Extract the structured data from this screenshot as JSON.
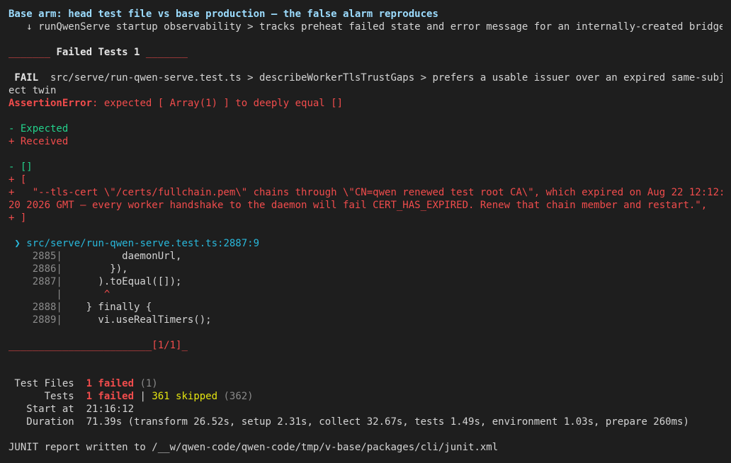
{
  "header": {
    "title": "Base arm: head test file vs base production — the false alarm reproduces",
    "skipped_line": "   ↓ runQwenServe startup observability > tracks preheat failed state and error message for an internally-created bridge"
  },
  "failed_banner": {
    "rule_left": "_______",
    "label": " Failed Tests 1 ",
    "rule_right": "_______"
  },
  "failure": {
    "badge": " FAIL ",
    "path_line1": " src/serve/run-qwen-serve.test.ts > describeWorkerTlsTrustGaps > prefers a usable issuer over an expired same-subj",
    "path_line2": "ect twin",
    "error_name": "AssertionError",
    "error_message": ": expected [ Array(1) ] to deeply equal []"
  },
  "diff": {
    "legend_expected": "- Expected",
    "legend_received": "+ Received",
    "lines": [
      {
        "type": "expected",
        "text": "- []"
      },
      {
        "type": "received",
        "text": "+ ["
      },
      {
        "type": "received",
        "text": "+   \"--tls-cert \\\"/certs/fullchain.pem\\\" chains through \\\"CN=qwen renewed test root CA\\\", which expired on Aug 22 12:12:"
      },
      {
        "type": "received",
        "text": "20 2026 GMT — every worker handshake to the daemon will fail CERT_HAS_EXPIRED. Renew that chain member and restart.\","
      },
      {
        "type": "received",
        "text": "+ ]"
      }
    ]
  },
  "location": {
    "arrow": " ❯ ",
    "path": "src/serve/run-qwen-serve.test.ts:2887:9"
  },
  "code": [
    {
      "gutter": "    2885|",
      "text": "          daemonUrl,",
      "kind": "code"
    },
    {
      "gutter": "    2886|",
      "text": "        }),",
      "kind": "code"
    },
    {
      "gutter": "    2887|",
      "text": "      ).toEqual([]);",
      "kind": "code"
    },
    {
      "gutter": "        |",
      "text": "       ^",
      "kind": "caret"
    },
    {
      "gutter": "    2888|",
      "text": "    } finally {",
      "kind": "code"
    },
    {
      "gutter": "    2889|",
      "text": "      vi.useRealTimers();",
      "kind": "code"
    }
  ],
  "footer_rule": {
    "rule": "________________________",
    "counter": "[1/1]",
    "tail": "_"
  },
  "summary": {
    "files_label": " Test Files  ",
    "files_failed": "1 failed",
    "files_total": " (1)",
    "tests_label": "      Tests  ",
    "tests_failed": "1 failed",
    "tests_sep": " | ",
    "tests_skipped": "361 skipped",
    "tests_total": " (362)",
    "start_label": "   Start at  ",
    "start_value": "21:16:12",
    "duration_label": "   Duration  ",
    "duration_value": "71.39s",
    "duration_detail": " (transform 26.52s, setup 2.31s, collect 32.67s, tests 1.49s, environment 1.03s, prepare 260ms)"
  },
  "junit": "JUNIT report written to /__w/qwen-code/qwen-code/tmp/v-base/packages/cli/junit.xml",
  "colors": {
    "background": "#1e1e1e",
    "title": "#9cdcfe",
    "red": "#f14c4c",
    "green": "#23d18b",
    "cyan": "#29b8db",
    "yellow": "#e5e510"
  }
}
